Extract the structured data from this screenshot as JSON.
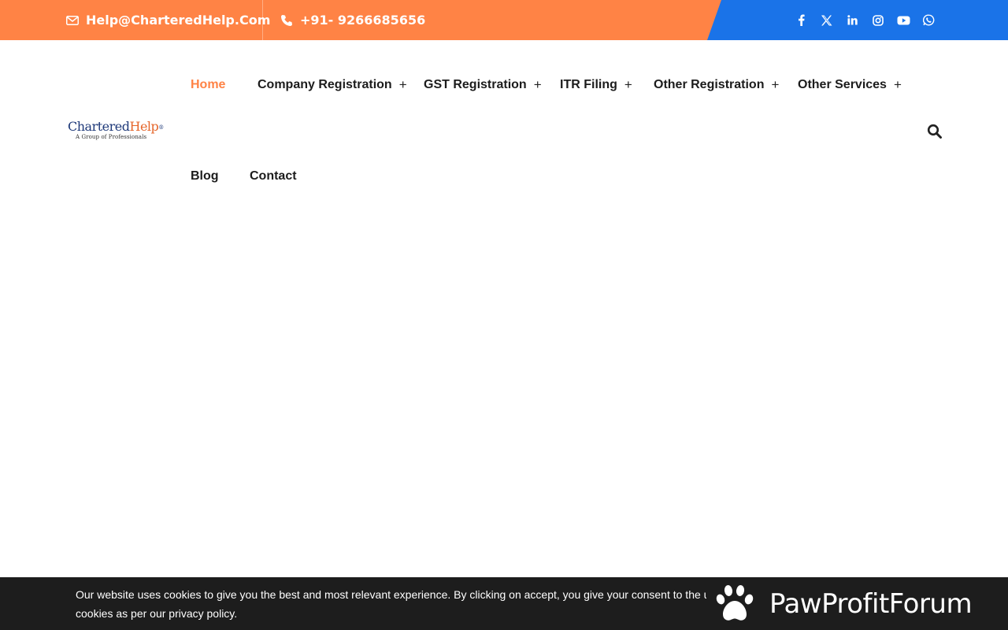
{
  "topbar": {
    "email": "Help@CharteredHelp.Com",
    "phone": "+91- 9266685656",
    "colors": {
      "orange": "#ff8345",
      "blue": "#1a73e8"
    },
    "socials": [
      "facebook-icon",
      "x-twitter-icon",
      "linkedin-icon",
      "instagram-icon",
      "youtube-icon",
      "whatsapp-icon"
    ]
  },
  "logo": {
    "part1": "Chartered",
    "part2": "Help",
    "mark": "®",
    "tagline": "A Group of Professionals"
  },
  "nav": {
    "items": [
      {
        "label": "Home",
        "active": true
      },
      {
        "label": "Company Registration",
        "plus": "+"
      },
      {
        "label": "GST Registration",
        "plus": "+"
      },
      {
        "label": "ITR Filing",
        "plus": "+"
      },
      {
        "label": "Other Registration",
        "plus": "+"
      },
      {
        "label": "Other Services",
        "plus": "+"
      },
      {
        "label": "Blog"
      },
      {
        "label": "Contact"
      }
    ],
    "search_icon": "search-icon"
  },
  "cookie": {
    "line1": "Our website uses cookies to give you the best and most relevant experience. By clicking on accept, you give your consent to the u",
    "line2": "cookies as per our privacy policy."
  },
  "badge": {
    "name": "PawProfitForum"
  }
}
